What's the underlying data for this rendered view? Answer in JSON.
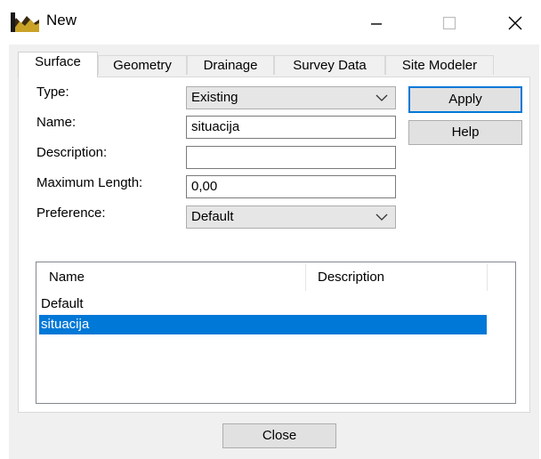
{
  "window": {
    "title": "New",
    "icon": "surface-app-icon",
    "controls": [
      "minimize-icon",
      "maximize-icon",
      "close-icon"
    ]
  },
  "tabs": [
    {
      "label": "Surface",
      "active": true
    },
    {
      "label": "Geometry",
      "active": false
    },
    {
      "label": "Drainage",
      "active": false
    },
    {
      "label": "Survey Data",
      "active": false
    },
    {
      "label": "Site Modeler",
      "active": false
    }
  ],
  "form": {
    "type_label": "Type:",
    "type_value": "Existing",
    "name_label": "Name:",
    "name_value": "situacija",
    "description_label": "Description:",
    "description_value": "",
    "max_length_label": "Maximum Length:",
    "max_length_value": "0,00",
    "preference_label": "Preference:",
    "preference_value": "Default"
  },
  "buttons": {
    "apply": "Apply",
    "help": "Help",
    "close": "Close"
  },
  "list": {
    "columns": [
      "Name",
      "Description"
    ],
    "rows": [
      {
        "name": "Default",
        "description": "",
        "selected": false
      },
      {
        "name": "situacija",
        "description": "",
        "selected": true
      }
    ]
  },
  "colors": {
    "selection": "#0078d7",
    "dialog_bg": "#f0f0f0",
    "button_bg": "#e1e1e1"
  }
}
